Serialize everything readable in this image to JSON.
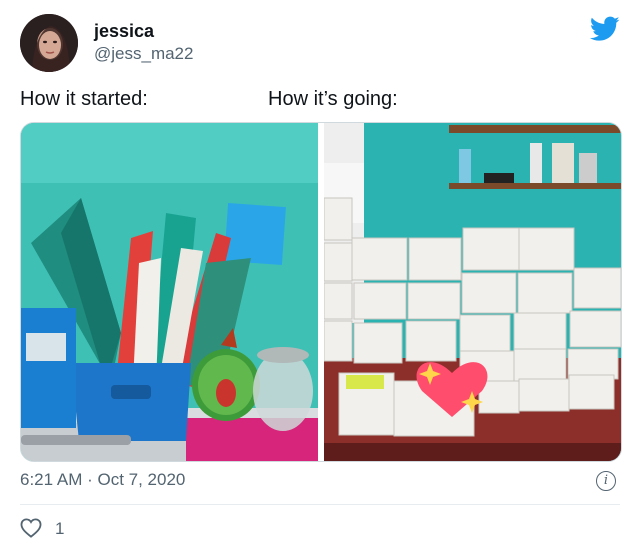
{
  "user": {
    "name": "jessica",
    "handle": "@jess_ma22"
  },
  "captions": {
    "left": "How it started:",
    "right": "How it’s going:"
  },
  "timestamp": "6:21 AM · Oct 7, 2020",
  "likes": "1",
  "colors": {
    "brand": "#1d9bf0",
    "muted": "#536471"
  },
  "icons": [
    "twitter-bird-icon",
    "info-icon",
    "heart-icon"
  ]
}
